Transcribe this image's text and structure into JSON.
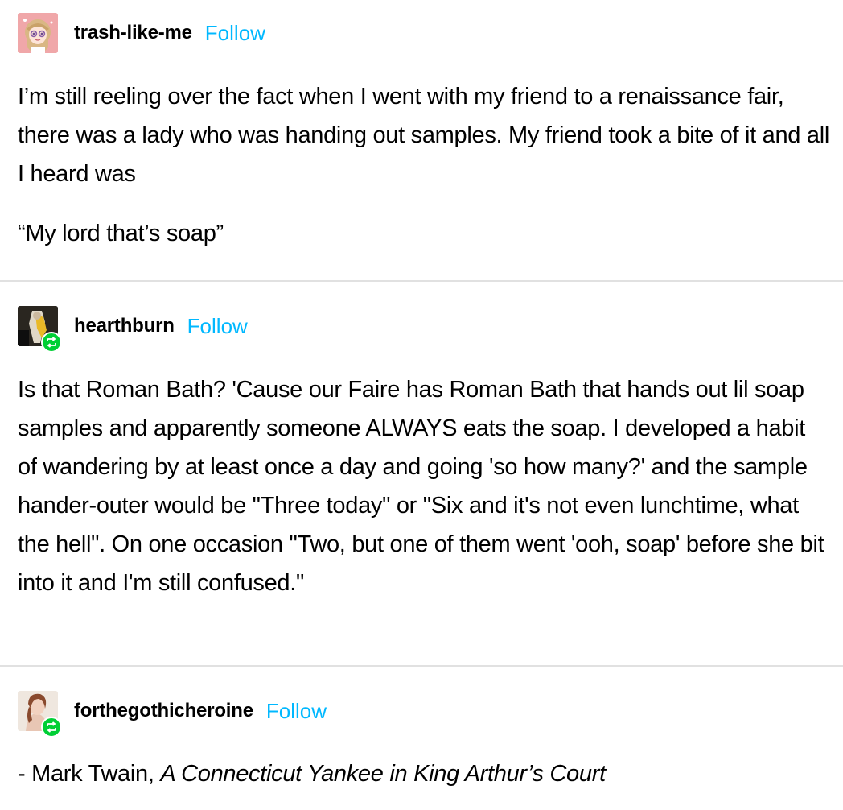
{
  "posts": [
    {
      "username": "trash-like-me",
      "follow_label": "Follow",
      "avatar_icon": "anime-girl-avatar",
      "reblogged": false,
      "paragraphs": [
        "I’m still reeling over the fact when I went with my friend to a renaissance fair, there was a lady who was handing out samples. My friend took a bite of it and all I heard was",
        "“My lord that’s soap”"
      ]
    },
    {
      "username": "hearthburn",
      "follow_label": "Follow",
      "avatar_icon": "dark-figure-avatar",
      "reblogged": true,
      "paragraphs": [
        "Is that Roman Bath? 'Cause our Faire has Roman Bath that hands out lil soap samples and apparently someone ALWAYS eats the soap. I developed a habit of wandering by at least once a day and going 'so how many?' and the sample hander-outer would be \"Three today\" or \"Six and it's not even lunchtime, what the hell\". On one occasion \"Two, but one of them went 'ooh, soap' before she bit into it and I'm still confused.\""
      ]
    },
    {
      "username": "forthegothicheroine",
      "follow_label": "Follow",
      "avatar_icon": "portrait-woman-avatar",
      "reblogged": true,
      "quote_prefix": "- Mark Twain, ",
      "quote_title": "A Connecticut Yankee in King Arthur’s Court"
    }
  ],
  "colors": {
    "follow": "#00b8ff",
    "reblog_badge": "#00cf35",
    "divider": "#e1e1e1"
  },
  "icons": {
    "reblog": "reblog-icon"
  }
}
